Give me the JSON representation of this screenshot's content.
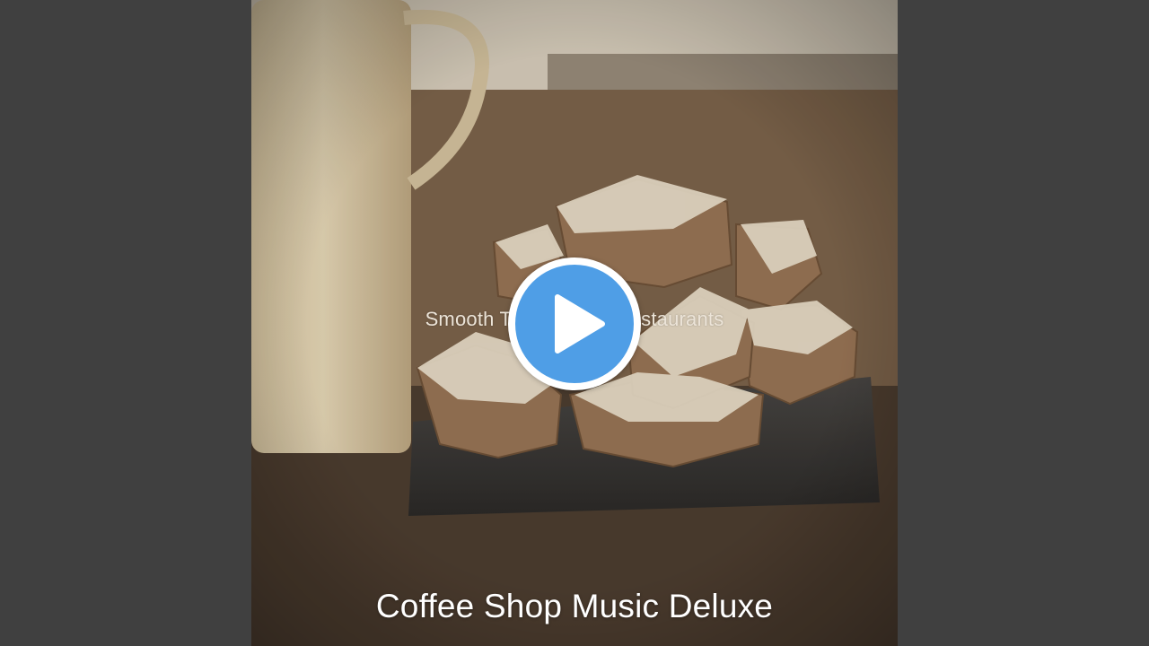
{
  "video": {
    "track_title": "Smooth Trio Jazz for Restaurants",
    "artist": "Coffee Shop Music Deluxe",
    "artwork_description_icon": "cookies-on-slate-image",
    "play_icon": "play-icon"
  },
  "colors": {
    "letterbox": "#404040",
    "play_accent": "#4f9ee6",
    "play_ring": "#ffffff"
  }
}
